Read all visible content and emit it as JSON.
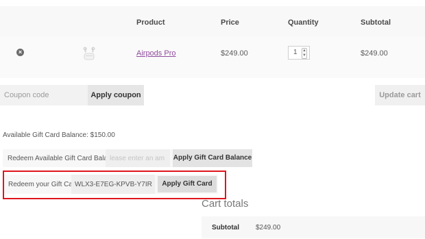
{
  "cart": {
    "headers": {
      "product": "Product",
      "price": "Price",
      "quantity": "Quantity",
      "subtotal": "Subtotal"
    },
    "items": [
      {
        "remove_symbol": "×",
        "thumbnail_icon": "airpods-thumbnail",
        "product": "Airpods Pro",
        "price": "$249.00",
        "quantity": "1",
        "subtotal": "$249.00"
      }
    ]
  },
  "coupon": {
    "placeholder": "Coupon code",
    "apply_label": "Apply coupon",
    "update_label": "Update cart"
  },
  "gift_card": {
    "balance_text": "Available Gift Card Balance: $150.00",
    "redeem_balance_label": "Redeem Available Gift Card Balance",
    "balance_placeholder": "lease enter an am",
    "apply_balance_label": "Apply Gift Card Balance",
    "redeem_card_label": "Redeem your Gift Card",
    "card_code_value": "WLX3-E7EG-KPVB-Y7IR",
    "apply_card_label": "Apply Gift Card",
    "highlight_color": "#e0131c"
  },
  "totals": {
    "title": "Cart totals",
    "subtotal_label": "Subtotal",
    "subtotal_value": "$249.00"
  },
  "colors": {
    "link": "#8e4a9d",
    "table_bg": "#f8f8f8"
  }
}
